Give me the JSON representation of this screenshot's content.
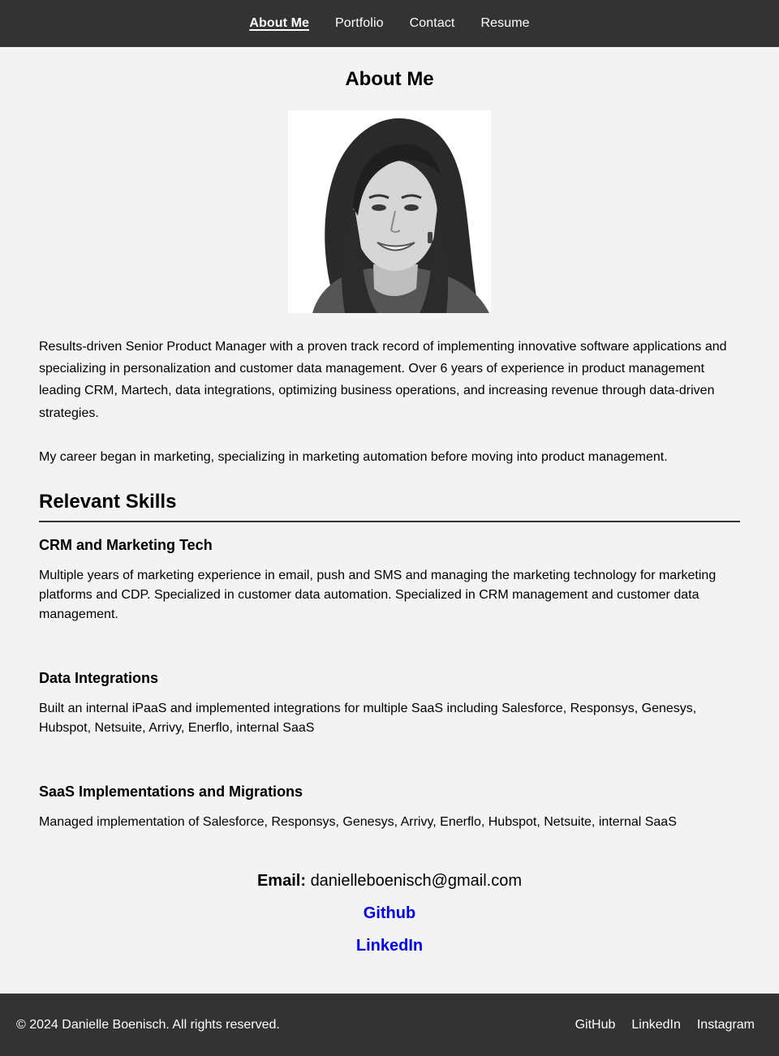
{
  "nav": {
    "items": [
      {
        "label": "About Me",
        "active": true
      },
      {
        "label": "Portfolio",
        "active": false
      },
      {
        "label": "Contact",
        "active": false
      },
      {
        "label": "Resume",
        "active": false
      }
    ]
  },
  "page": {
    "title": "About Me"
  },
  "intro": {
    "paragraph1": "Results-driven Senior Product Manager with a proven track record of implementing innovative software applications and specializing in personalization and customer data management. Over 6 years of experience in product management leading CRM, Martech, data integrations, optimizing business operations, and increasing revenue through data-driven strategies.",
    "paragraph2": "My career began in marketing, specializing in marketing automation before moving into product management."
  },
  "skills": {
    "heading": "Relevant Skills",
    "items": [
      {
        "title": "CRM and Marketing Tech",
        "description": "Multiple years of marketing experience in email, push and SMS and managing the marketing technology for marketing platforms and CDP. Specialized in customer data automation. Specialized in CRM management and customer data management."
      },
      {
        "title": "Data Integrations",
        "description": "Built an internal iPaaS and implemented integrations for multiple SaaS including Salesforce, Responsys, Genesys, Hubspot, Netsuite, Arrivy, Enerflo, internal SaaS"
      },
      {
        "title": "SaaS Implementations and Migrations",
        "description": "Managed implementation of Salesforce, Responsys, Genesys, Arrivy, Enerflo, Hubspot, Netsuite, internal SaaS"
      }
    ]
  },
  "contact": {
    "email_label": "Email:",
    "email": "danielleboenisch@gmail.com",
    "links": [
      "Github",
      "LinkedIn"
    ]
  },
  "footer": {
    "copyright": "© 2024 Danielle Boenisch. All rights reserved.",
    "links": [
      "GitHub",
      "LinkedIn",
      "Instagram"
    ]
  },
  "colors": {
    "nav_bg": "#333333",
    "page_bg": "#f3f3f3",
    "link": "#0000ee"
  }
}
